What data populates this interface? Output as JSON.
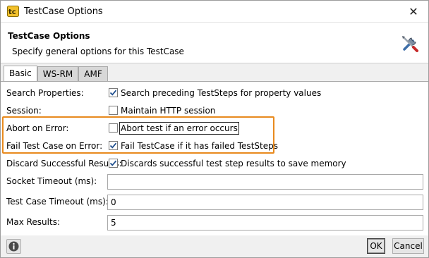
{
  "window": {
    "title": "TestCase Options",
    "close_glyph": "✕",
    "icon": "soapui-app-icon"
  },
  "header": {
    "title": "TestCase Options",
    "description": "Specify general options for this TestCase",
    "icon": "tools-icon"
  },
  "tabs": [
    {
      "label": "Basic",
      "active": true
    },
    {
      "label": "WS-RM",
      "active": false
    },
    {
      "label": "AMF",
      "active": false
    }
  ],
  "options": {
    "search_properties": {
      "label": "Search Properties:",
      "text": "Search preceding TestSteps for property values",
      "checked": true
    },
    "session": {
      "label": "Session:",
      "text": "Maintain HTTP session",
      "checked": false
    },
    "abort_on_error": {
      "label": "Abort on Error:",
      "text": "Abort test if an error occurs",
      "checked": false
    },
    "fail_on_error": {
      "label": "Fail Test Case on Error:",
      "text": "Fail TestCase if it has failed TestSteps",
      "checked": true
    },
    "discard_results": {
      "label": "Discard Successful Results:",
      "text": "Discards successful test step results to save memory",
      "checked": true
    }
  },
  "fields": {
    "socket_timeout": {
      "label": "Socket Timeout (ms):",
      "value": ""
    },
    "testcase_timeout": {
      "label": "Test Case Timeout (ms):",
      "value": "0"
    },
    "max_results": {
      "label": "Max Results:",
      "value": "5"
    }
  },
  "footer": {
    "ok_label": "OK",
    "cancel_label": "Cancel"
  },
  "colors": {
    "highlight": "#e88a1e",
    "checkmark": "#1f4f8f"
  }
}
